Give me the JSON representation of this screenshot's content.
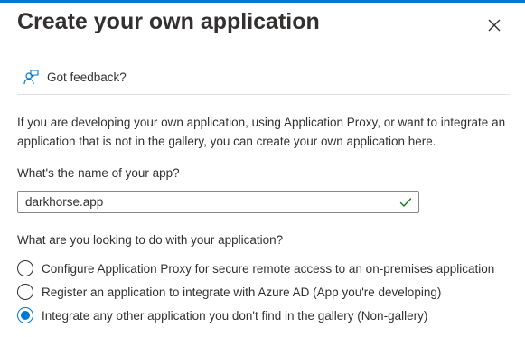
{
  "panel": {
    "title": "Create your own application",
    "close_icon": "close-icon"
  },
  "feedback": {
    "icon": "feedback-person-icon",
    "label": "Got feedback?"
  },
  "description": "If you are developing your own application, using Application Proxy, or want to integrate an application that is not in the gallery, you can create your own application here.",
  "app_name": {
    "label": "What's the name of your app?",
    "value": "darkhorse.app",
    "valid_icon": "checkmark-icon"
  },
  "purpose": {
    "label": "What are you looking to do with your application?",
    "options": [
      {
        "label": "Configure Application Proxy for secure remote access to an on-premises application",
        "selected": false
      },
      {
        "label": "Register an application to integrate with Azure AD (App you're developing)",
        "selected": false
      },
      {
        "label": "Integrate any other application you don't find in the gallery (Non-gallery)",
        "selected": true
      }
    ]
  },
  "colors": {
    "accent": "#0078d4",
    "valid": "#107c10",
    "text": "#323130",
    "border": "#8a8886"
  }
}
